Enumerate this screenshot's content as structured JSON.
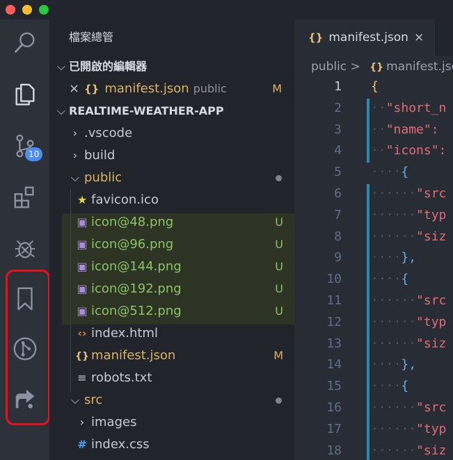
{
  "explorer": {
    "title": "檔案總管",
    "open_editors": {
      "header": "已開啟的編輯器",
      "items": [
        {
          "close_glyph": "×",
          "icon": "{}",
          "name": "manifest.json",
          "folder": "public",
          "status": "M"
        }
      ]
    },
    "project": {
      "header": "REALTIME-WEATHER-APP",
      "tree": [
        {
          "name": ".vscode",
          "kind": "folder",
          "expanded": false
        },
        {
          "name": "build",
          "kind": "folder",
          "expanded": false
        },
        {
          "name": "public",
          "kind": "folder",
          "expanded": true,
          "dot": true
        },
        {
          "name": "favicon.ico",
          "kind": "file",
          "icon": "star-icon"
        },
        {
          "name": "icon@48.png",
          "kind": "file",
          "icon": "image-icon",
          "status": "U"
        },
        {
          "name": "icon@96.png",
          "kind": "file",
          "icon": "image-icon",
          "status": "U"
        },
        {
          "name": "icon@144.png",
          "kind": "file",
          "icon": "image-icon",
          "status": "U"
        },
        {
          "name": "icon@192.png",
          "kind": "file",
          "icon": "image-icon",
          "status": "U"
        },
        {
          "name": "icon@512.png",
          "kind": "file",
          "icon": "image-icon",
          "status": "U"
        },
        {
          "name": "index.html",
          "kind": "file",
          "icon": "html-icon"
        },
        {
          "name": "manifest.json",
          "kind": "file",
          "icon": "json-icon",
          "status": "M"
        },
        {
          "name": "robots.txt",
          "kind": "file",
          "icon": "text-icon"
        },
        {
          "name": "src",
          "kind": "folder",
          "expanded": true,
          "dot": true
        },
        {
          "name": "images",
          "kind": "folder",
          "expanded": false
        },
        {
          "name": "index.css",
          "kind": "file",
          "icon": "css-hash-icon"
        }
      ]
    }
  },
  "activity_bar": {
    "items": [
      "search-icon",
      "explorer-files-icon",
      "source-control-icon",
      "extensions-icon",
      "debug-bug-icon",
      "bookmark-icon",
      "git-graph-icon",
      "live-share-icon"
    ],
    "source_control_badge": "10"
  },
  "editor": {
    "tab": {
      "icon": "{}",
      "label": "manifest.json",
      "close": "×"
    },
    "breadcrumb": {
      "folder": "public",
      "separator": ">",
      "icon": "{}",
      "file": "manifest.jso"
    },
    "lines": [
      {
        "n": "1",
        "text": "{"
      },
      {
        "n": "2",
        "text": "\"short_n"
      },
      {
        "n": "3",
        "text": "\"name\": "
      },
      {
        "n": "4",
        "text": "\"icons\":"
      },
      {
        "n": "5",
        "text": "{"
      },
      {
        "n": "6",
        "text": "\"src"
      },
      {
        "n": "7",
        "text": "\"typ"
      },
      {
        "n": "8",
        "text": "\"siz"
      },
      {
        "n": "9",
        "text": "},"
      },
      {
        "n": "10",
        "text": "{"
      },
      {
        "n": "11",
        "text": "\"src"
      },
      {
        "n": "12",
        "text": "\"typ"
      },
      {
        "n": "13",
        "text": "\"siz"
      },
      {
        "n": "14",
        "text": "},"
      },
      {
        "n": "15",
        "text": "{"
      },
      {
        "n": "16",
        "text": "\"src"
      },
      {
        "n": "17",
        "text": "\"typ"
      },
      {
        "n": "18",
        "text": "\"siz"
      }
    ]
  },
  "colors": {
    "activity_bg": "#2c313a",
    "sidebar_bg": "#21252b",
    "editor_bg": "#282c34",
    "untracked_green": "#8cc265",
    "modified_yellow": "#d9b35f",
    "badge_blue": "#4d8ef0",
    "highlight_red": "#e8101a",
    "string_red": "#e06c75"
  }
}
